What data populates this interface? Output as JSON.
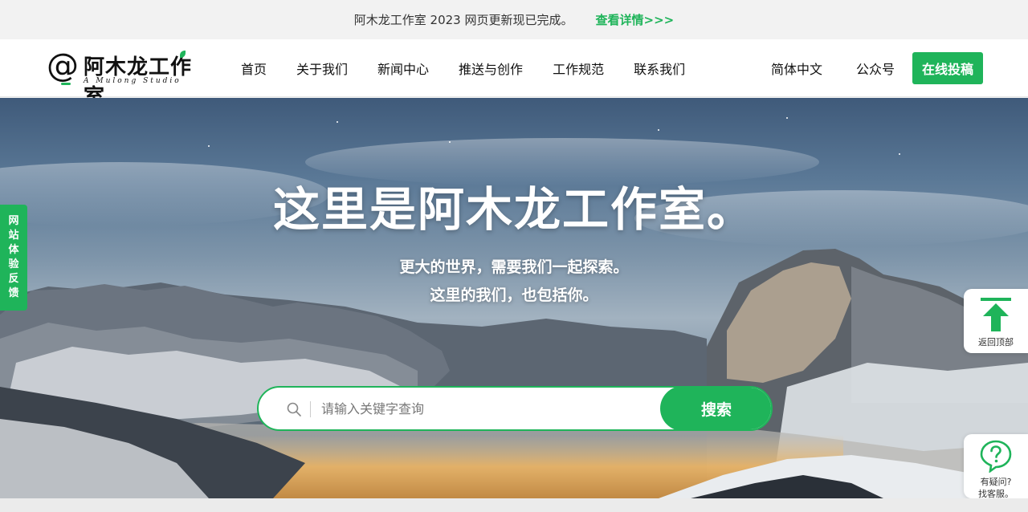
{
  "announcement": {
    "text": "阿木龙工作室 2023 网页更新现已完成。",
    "link": "查看详情>>>"
  },
  "logo": {
    "at": "@",
    "name": "阿木龙工作室",
    "sub": "A Mulong Studio"
  },
  "nav": {
    "items": [
      "首页",
      "关于我们",
      "新闻中心",
      "推送与创作",
      "工作规范",
      "联系我们"
    ]
  },
  "right_nav": {
    "language": "简体中文",
    "official": "公众号",
    "submit": "在线投稿"
  },
  "hero": {
    "headline": "这里是阿木龙工作室。",
    "sub1": "更大的世界，需要我们一起探索。",
    "sub2": "这里的我们，也包括你。"
  },
  "search": {
    "placeholder": "请输入关键字查询",
    "button": "搜索"
  },
  "feedback": {
    "chars": [
      "网",
      "站",
      "体",
      "验",
      "反",
      "馈"
    ]
  },
  "float": {
    "back_top": "返回顶部",
    "help_line1": "有疑问?",
    "help_line2": "找客服。"
  },
  "colors": {
    "accent": "#1fb45a"
  }
}
